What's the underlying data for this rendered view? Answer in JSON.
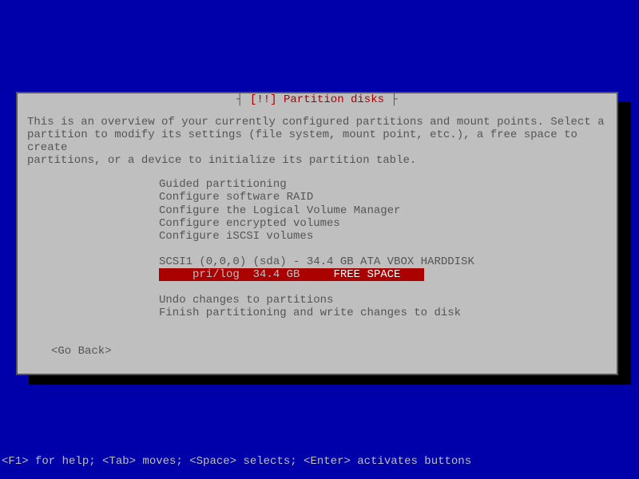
{
  "title": {
    "prefix_dash": "┤ ",
    "bang": "[!!] ",
    "text": "Partition disks",
    "suffix_dash": " ├"
  },
  "intro": "This is an overview of your currently configured partitions and mount points. Select a\npartition to modify its settings (file system, mount point, etc.), a free space to create\npartitions, or a device to initialize its partition table.",
  "options": {
    "guided": "Guided partitioning",
    "raid": "Configure software RAID",
    "lvm": "Configure the Logical Volume Manager",
    "encrypted": "Configure encrypted volumes",
    "iscsi": "Configure iSCSI volumes",
    "disk_header": "SCSI1 (0,0,0) (sda) - 34.4 GB ATA VBOX HARDDISK",
    "selected_prefix": "     pri/log  34.4 GB     ",
    "selected_free": "FREE SPACE   ",
    "undo": "Undo changes to partitions",
    "finish": "Finish partitioning and write changes to disk"
  },
  "go_back": "<Go Back>",
  "helpbar": "<F1> for help; <Tab> moves; <Space> selects; <Enter> activates buttons"
}
